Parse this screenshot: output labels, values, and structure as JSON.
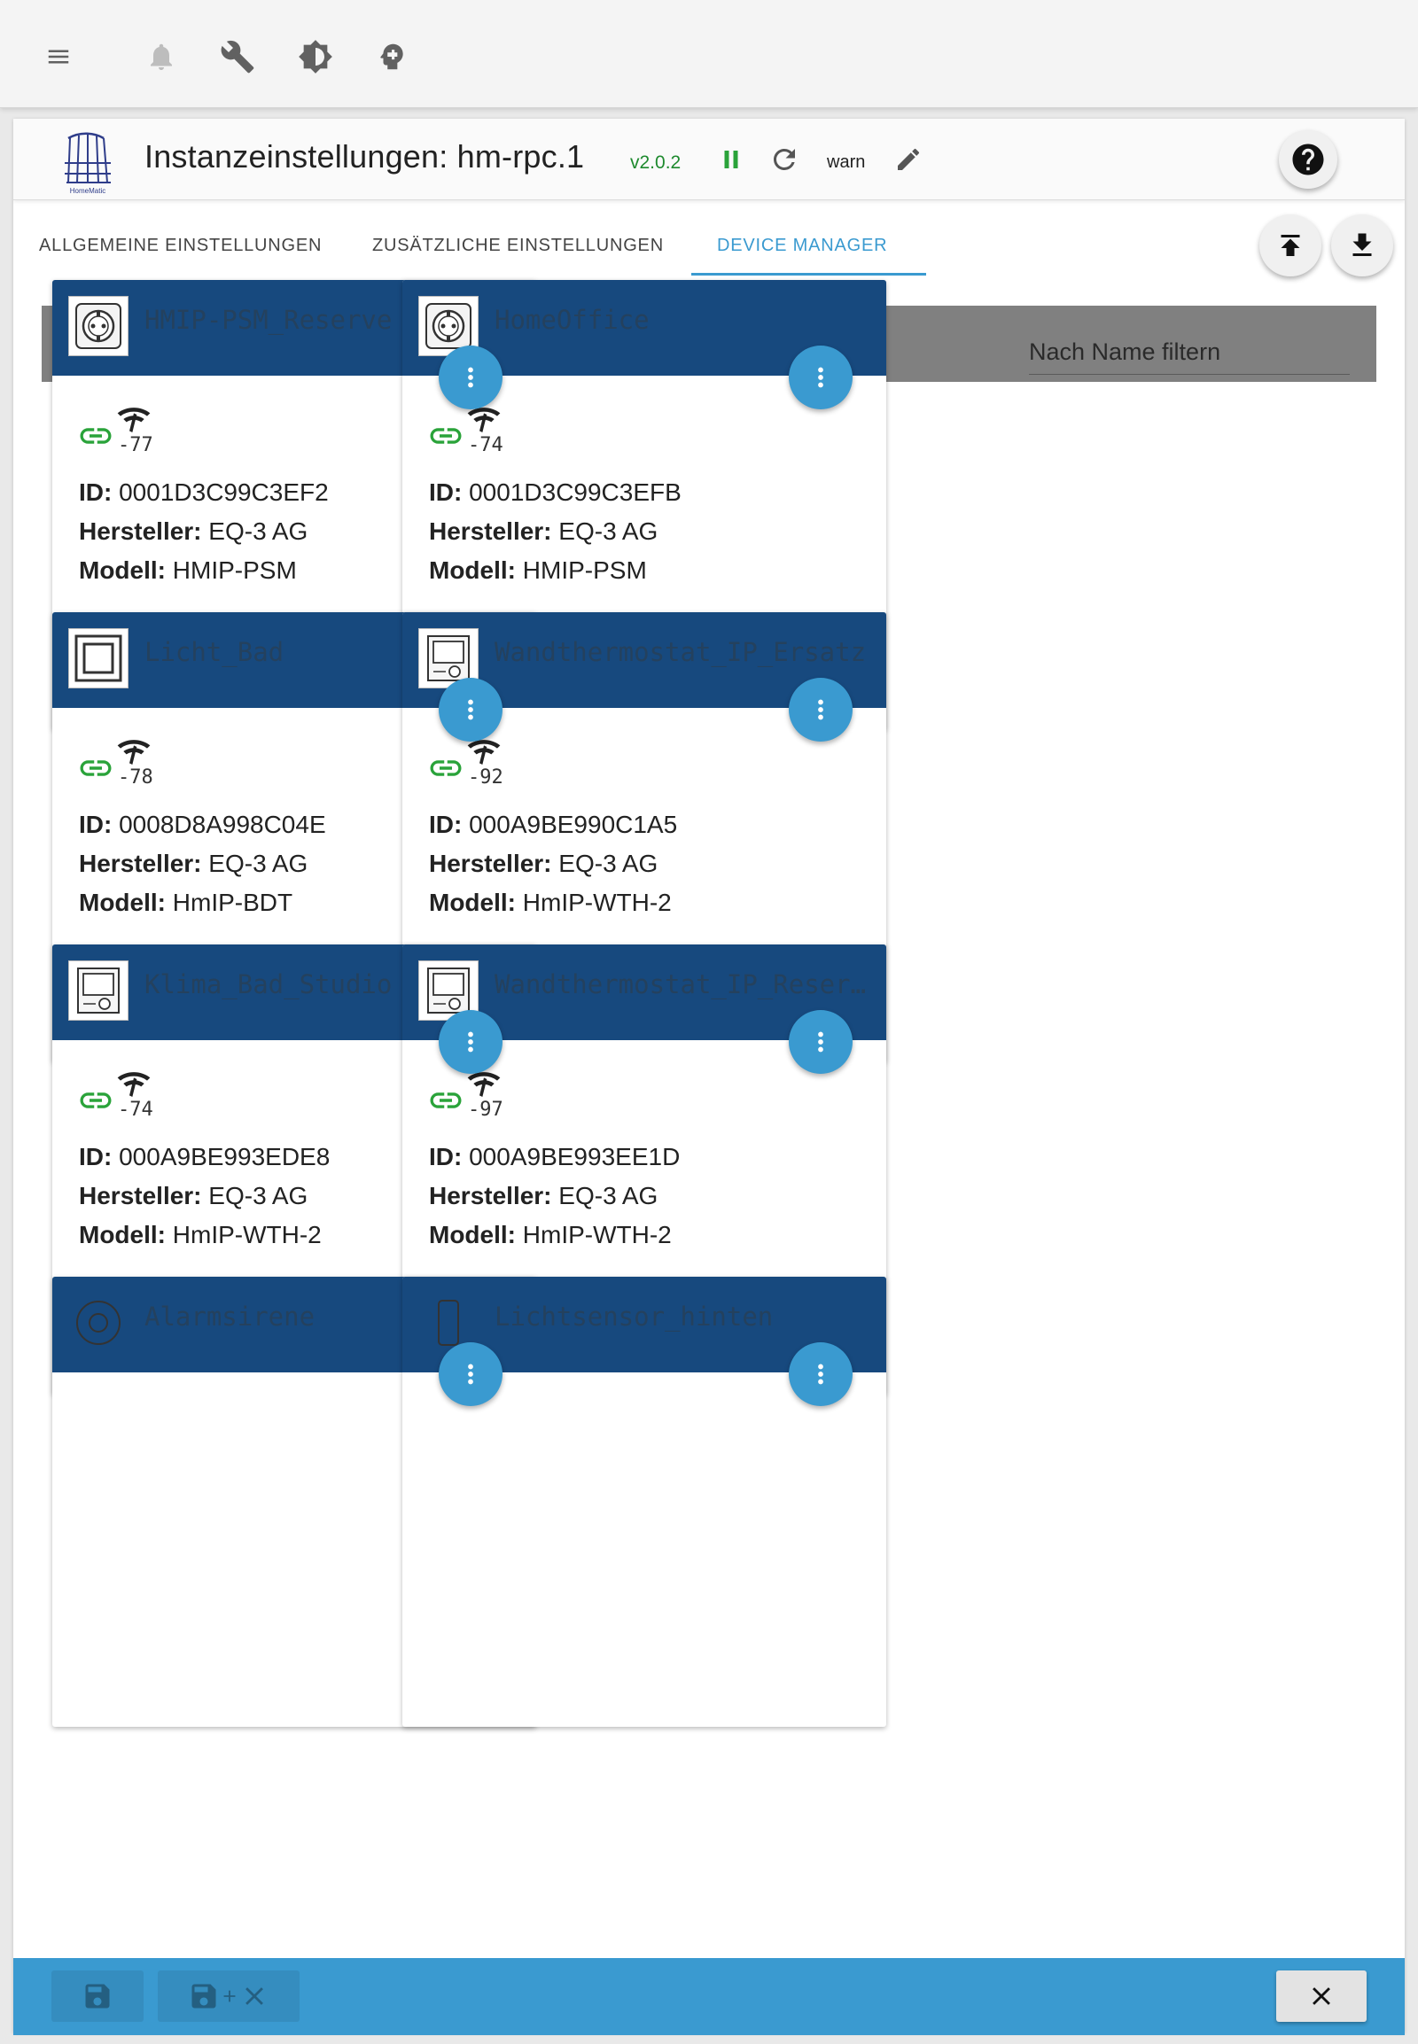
{
  "toolbar": {
    "icons": [
      "menu-icon",
      "bell-icon",
      "wrench-icon",
      "brightness-icon",
      "expert-mode-icon"
    ]
  },
  "header": {
    "title": "Instanzeinstellungen: hm-rpc.1",
    "version": "v2.0.2",
    "log_level": "warn",
    "logo_caption": "HomeMatic",
    "status_color": "#2aa33a"
  },
  "tabs": [
    {
      "label": "ALLGEMEINE EINSTELLUNGEN",
      "active": false
    },
    {
      "label": "ZUSÄTZLICHE EINSTELLUNGEN",
      "active": false
    },
    {
      "label": "DEVICE MANAGER",
      "active": true
    }
  ],
  "filter": {
    "placeholder": "Nach Name filtern"
  },
  "labels": {
    "id": "ID:",
    "manufacturer": "Hersteller:",
    "model": "Modell:"
  },
  "devices": [
    {
      "name": "HMIP-PSM_Reserve",
      "rssi": "-77",
      "id": "0001D3C99C3EF2",
      "manufacturer": "EQ-3 AG",
      "model": "HMIP-PSM",
      "image": "socket-icon"
    },
    {
      "name": "HomeOffice",
      "rssi": "-74",
      "id": "0001D3C99C3EFB",
      "manufacturer": "EQ-3 AG",
      "model": "HMIP-PSM",
      "image": "socket-icon"
    },
    {
      "name": "Licht_Bad",
      "rssi": "-78",
      "id": "0008D8A998C04E",
      "manufacturer": "EQ-3 AG",
      "model": "HmIP-BDT",
      "image": "dimmer-icon"
    },
    {
      "name": "Wandthermostat_IP_Ersatz",
      "rssi": "-92",
      "id": "000A9BE990C1A5",
      "manufacturer": "EQ-3 AG",
      "model": "HmIP-WTH-2",
      "image": "thermostat-icon"
    },
    {
      "name": "Klima_Bad_Studio",
      "rssi": "-74",
      "id": "000A9BE993EDE8",
      "manufacturer": "EQ-3 AG",
      "model": "HmIP-WTH-2",
      "image": "thermostat-icon"
    },
    {
      "name": "Wandthermostat_IP_Reserve",
      "rssi": "-97",
      "id": "000A9BE993EE1D",
      "manufacturer": "EQ-3 AG",
      "model": "HmIP-WTH-2",
      "image": "thermostat-icon"
    },
    {
      "name": "Alarmsirene",
      "rssi": "",
      "id": "",
      "manufacturer": "",
      "model": "",
      "image": "siren-icon"
    },
    {
      "name": "Lichtsensor_hinten",
      "rssi": "",
      "id": "",
      "manufacturer": "",
      "model": "",
      "image": "light-sensor-icon"
    }
  ],
  "colors": {
    "accent": "#3a9ad0",
    "card_header": "#17497e",
    "connected": "#2aa33a",
    "filter_bar": "#808080"
  }
}
